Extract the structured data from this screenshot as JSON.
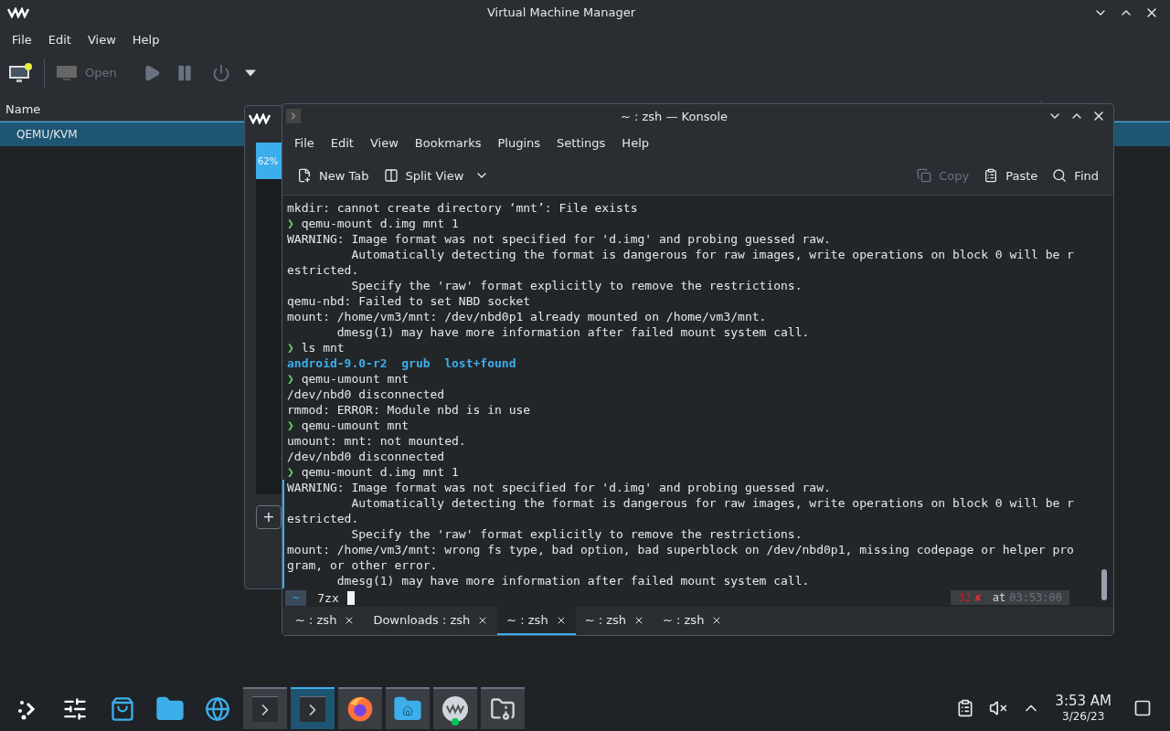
{
  "vmm": {
    "title": "Virtual Machine Manager",
    "menu": [
      "File",
      "Edit",
      "View",
      "Help"
    ],
    "open_label": "Open",
    "column": "Name",
    "rows": [
      {
        "name": "QEMU/KVM",
        "selected": true
      }
    ]
  },
  "dialog": {
    "progress": "62%",
    "add": "+"
  },
  "konsole": {
    "title": "~ : zsh — Konsole",
    "menu": [
      "File",
      "Edit",
      "View",
      "Bookmarks",
      "Plugins",
      "Settings",
      "Help"
    ],
    "toolbar": [
      {
        "kind": "new-tab",
        "label": "New Tab",
        "disabled": false
      },
      {
        "kind": "split",
        "label": "Split View",
        "disabled": false
      },
      {
        "kind": "copy",
        "label": "Copy",
        "disabled": true
      },
      {
        "kind": "paste",
        "label": "Paste",
        "disabled": false
      },
      {
        "kind": "find",
        "label": "Find",
        "disabled": false
      }
    ],
    "lines": [
      {
        "kind": "output",
        "text": "mkdir: cannot create directory ‘mnt’: File exists"
      },
      {
        "kind": "prompt",
        "symbol": "❯",
        "text": "qemu-mount d.img mnt 1"
      },
      {
        "kind": "output",
        "text": "WARNING: Image format was not specified for 'd.img' and probing guessed raw."
      },
      {
        "kind": "output",
        "text": "         Automatically detecting the format is dangerous for raw images, write operations on block 0 will be r"
      },
      {
        "kind": "output",
        "text": "estricted."
      },
      {
        "kind": "output",
        "text": "         Specify the 'raw' format explicitly to remove the restrictions."
      },
      {
        "kind": "output",
        "text": "qemu-nbd: Failed to set NBD socket"
      },
      {
        "kind": "output",
        "text": "mount: /home/vm3/mnt: /dev/nbd0p1 already mounted on /home/vm3/mnt."
      },
      {
        "kind": "output",
        "text": "       dmesg(1) may have more information after failed mount system call."
      },
      {
        "kind": "prompt",
        "symbol": "❯",
        "text": "ls mnt"
      },
      {
        "kind": "listing",
        "items": [
          "android-9.0-r2",
          "grub",
          "lost+found"
        ]
      },
      {
        "kind": "prompt",
        "symbol": "❯",
        "text": "qemu-umount mnt"
      },
      {
        "kind": "output",
        "text": "/dev/nbd0 disconnected"
      },
      {
        "kind": "output",
        "text": "rmmod: ERROR: Module nbd is in use"
      },
      {
        "kind": "prompt",
        "symbol": "❯",
        "text": "qemu-umount mnt"
      },
      {
        "kind": "output",
        "text": "umount: mnt: not mounted."
      },
      {
        "kind": "output",
        "text": "/dev/nbd0 disconnected"
      },
      {
        "kind": "prompt",
        "symbol": "❯",
        "text": "qemu-mount d.img mnt 1"
      }
    ],
    "last_output": [
      {
        "kind": "output",
        "text": "WARNING: Image format was not specified for 'd.img' and probing guessed raw."
      },
      {
        "kind": "output",
        "text": "         Automatically detecting the format is dangerous for raw images, write operations on block 0 will be r"
      },
      {
        "kind": "output",
        "text": "estricted."
      },
      {
        "kind": "output",
        "text": "         Specify the 'raw' format explicitly to remove the restrictions."
      },
      {
        "kind": "output",
        "text": "mount: /home/vm3/mnt: wrong fs type, bad option, bad superblock on /dev/nbd0p1, missing codepage or helper pro"
      },
      {
        "kind": "output",
        "text": "gram, or other error."
      },
      {
        "kind": "output",
        "text": "       dmesg(1) may have more information after failed mount system call."
      }
    ],
    "prompt": {
      "dir": "~",
      "input": "7zx",
      "status": "32",
      "fail": "✘",
      "at": "at",
      "time": "03:53:00"
    },
    "tabs": [
      {
        "label": "~ : zsh",
        "selected": false
      },
      {
        "label": "Downloads : zsh",
        "selected": false
      },
      {
        "label": "~ : zsh",
        "selected": true
      },
      {
        "label": "~ : zsh",
        "selected": false
      },
      {
        "label": "~ : zsh",
        "selected": false
      }
    ]
  },
  "taskbar": {
    "items": [
      {
        "kind": "launcher",
        "running": false,
        "selected": false
      },
      {
        "kind": "settings",
        "running": false,
        "selected": false
      },
      {
        "kind": "store",
        "running": false,
        "selected": false
      },
      {
        "kind": "files",
        "running": false,
        "selected": false
      },
      {
        "kind": "globe",
        "running": false,
        "selected": false
      },
      {
        "kind": "terminal",
        "running": true,
        "selected": false
      },
      {
        "kind": "terminal",
        "running": true,
        "selected": true
      },
      {
        "kind": "firefox",
        "running": true,
        "selected": false
      },
      {
        "kind": "home",
        "running": true,
        "selected": false
      },
      {
        "kind": "vmm",
        "running": true,
        "selected": false
      },
      {
        "kind": "archive",
        "running": true,
        "selected": false
      }
    ],
    "time": "3:53 AM",
    "date": "3/26/23"
  }
}
